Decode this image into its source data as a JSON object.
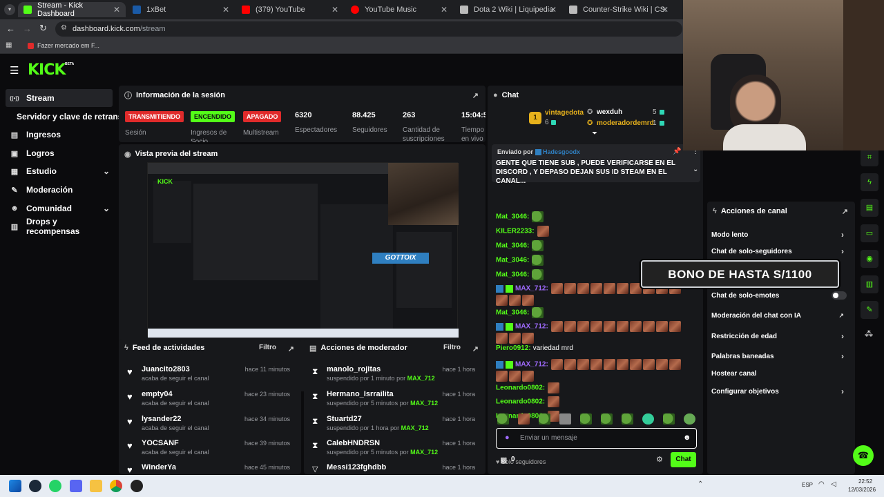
{
  "browser": {
    "tabs": [
      {
        "title": "Stream - Kick Dashboard",
        "color": "#53fc18",
        "active": true
      },
      {
        "title": "1xBet",
        "color": "#1a5aa6"
      },
      {
        "title": "(379) YouTube",
        "color": "#ff0000"
      },
      {
        "title": "YouTube Music",
        "color": "#ff0000"
      },
      {
        "title": "Dota 2 Wiki | Liquipedia",
        "color": "#bbbbbb"
      },
      {
        "title": "Counter-Strike Wiki | CS2 | Liqu",
        "color": "#bbbbbb"
      }
    ],
    "url": "dashboard.kick.com/stream",
    "url_host": "dashboard.kick.com",
    "url_path": "/stream",
    "bookmark": "Fazer mercado em F..."
  },
  "logo": {
    "text": "KICK",
    "badge": "BETA"
  },
  "sidebar": {
    "items": [
      {
        "label": "Stream",
        "icon": "broadcast-icon",
        "glyph": "((•))"
      },
      {
        "label": "Servidor y clave de retransmisión",
        "icon": "",
        "glyph": ""
      },
      {
        "label": "Ingresos",
        "icon": "money-icon",
        "glyph": "▤"
      },
      {
        "label": "Logros",
        "icon": "trophy-icon",
        "glyph": "▣"
      },
      {
        "label": "Estudio",
        "icon": "studio-icon",
        "glyph": "▦"
      },
      {
        "label": "Moderación",
        "icon": "wrench-icon",
        "glyph": "✎"
      },
      {
        "label": "Comunidad",
        "icon": "people-icon",
        "glyph": "☻"
      },
      {
        "label": "Drops y recompensas",
        "icon": "gift-icon",
        "glyph": "▥"
      }
    ]
  },
  "session": {
    "title": "Información de la sesión",
    "stats": [
      {
        "value": "TRANSMITIENDO",
        "label": "Sesión",
        "kind": "badge",
        "color": "#e02b2b"
      },
      {
        "value": "ENCENDIDO",
        "label": "Ingresos de Socio",
        "kind": "badge",
        "color": "#53fc18"
      },
      {
        "value": "APAGADO",
        "label": "Multistream",
        "kind": "badge",
        "color": "#e02b2b"
      },
      {
        "value": "6320",
        "label": "Espectadores",
        "kind": "num"
      },
      {
        "value": "88.425",
        "label": "Seguidores",
        "kind": "num"
      },
      {
        "value": "263",
        "label": "Cantidad de suscripciones",
        "kind": "num"
      },
      {
        "value": "15:04:5",
        "label": "Tiempo en vivo",
        "kind": "num"
      }
    ]
  },
  "preview": {
    "title": "Vista previa del stream",
    "overlay_name": "GOTTOIX"
  },
  "activity": {
    "title": "Feed de actividades",
    "filter": "Filtro",
    "rows": [
      {
        "name": "Juancito2803",
        "sub": "acaba de seguir el canal",
        "time": "hace 11 minutos"
      },
      {
        "name": "empty04",
        "sub": "acaba de seguir el canal",
        "time": "hace 23 minutos"
      },
      {
        "name": "lysander22",
        "sub": "acaba de seguir el canal",
        "time": "hace 34 minutos"
      },
      {
        "name": "YOCSANF",
        "sub": "acaba de seguir el canal",
        "time": "hace 39 minutos"
      },
      {
        "name": "WinderYa",
        "sub": "",
        "time": "hace 45 minutos"
      }
    ]
  },
  "modactions": {
    "title": "Acciones de moderador",
    "filter": "Filtro",
    "rows": [
      {
        "name": "manolo_rojitas",
        "sub": "suspendido por 1 minuto por",
        "by": "MAX_712",
        "time": "hace 1 hora"
      },
      {
        "name": "Hermano_Isrrailita",
        "sub": "suspendido por 5 minutos por",
        "by": "MAX_712",
        "time": "hace 1 hora"
      },
      {
        "name": "Stuartd27",
        "sub": "suspendido por 1 hora por",
        "by": "MAX_712",
        "time": "hace 1 hora"
      },
      {
        "name": "CalebHNDRSN",
        "sub": "suspendido por 5 minutos por",
        "by": "MAX_712",
        "time": "hace 1 hora"
      },
      {
        "name": "Messi123fghdbb",
        "sub": "",
        "by": "",
        "time": "hace 1 hora"
      }
    ]
  },
  "chat": {
    "title": "Chat",
    "leaderboard": [
      {
        "rank": "1",
        "name": "vintagedota",
        "count": "6"
      },
      {
        "name": "wexduh",
        "count": "5"
      },
      {
        "name": "moderadordemrd",
        "count": "1"
      }
    ],
    "pinned": {
      "prefix": "Enviado por",
      "author": "Hadesgoodx",
      "text": "GENTE QUE TIENE SUB , PUEDE VERIFICARSE EN EL DISCORD , Y DEPASO DEJAN SUS ID STEAM EN EL CANAL..."
    },
    "messages": [
      {
        "user": "Mat_3046:",
        "emotes": 1,
        "kind": "frog"
      },
      {
        "user": "KILER2233:",
        "emotes": 1,
        "kind": "face"
      },
      {
        "user": "Mat_3046:",
        "emotes": 1,
        "kind": "frog"
      },
      {
        "user": "Mat_3046:",
        "emotes": 1,
        "kind": "frog"
      },
      {
        "user": "Mat_3046:",
        "emotes": 1,
        "kind": "frog"
      },
      {
        "user": "MAX_712:",
        "emotes": 13,
        "kind": "face",
        "mod": true
      },
      {
        "user": "Mat_3046:",
        "emotes": 1,
        "kind": "frog"
      },
      {
        "user": "MAX_712:",
        "emotes": 13,
        "kind": "face",
        "mod": true
      },
      {
        "user": "Piero0912:",
        "text": "variedad mrd"
      },
      {
        "user": "MAX_712:",
        "emotes": 13,
        "kind": "face",
        "mod": true
      },
      {
        "user": "Leonardo0802:",
        "emotes": 1,
        "kind": "face"
      },
      {
        "user": "Leonardo0802:",
        "emotes": 1,
        "kind": "face"
      },
      {
        "user": "Leonardo0802:",
        "emotes": 1,
        "kind": "face"
      }
    ],
    "mode": "Solo seguidores",
    "input_placeholder": "Enviar un mensaje",
    "points": "0",
    "send": "Chat"
  },
  "channel_actions": {
    "title": "Acciones de canal",
    "items": [
      {
        "label": "Modo lento",
        "control": "chevron"
      },
      {
        "label": "Chat de solo-seguidores",
        "control": "chevron"
      },
      {
        "label": "Chat de solo-emotes",
        "control": "toggle"
      },
      {
        "label": "Moderación del chat con IA",
        "control": "external"
      },
      {
        "label": "Restricción de edad",
        "control": "chevron"
      },
      {
        "label": "Palabras baneadas",
        "control": "chevron"
      },
      {
        "label": "Hostear canal",
        "control": "none"
      },
      {
        "label": "Configurar objetivos",
        "control": "chevron"
      }
    ]
  },
  "overlay_banner": "BONO DE HASTA S/1100",
  "taskbar": {
    "lang": "ESP",
    "time": "22:52",
    "date": "12/03/2026"
  }
}
